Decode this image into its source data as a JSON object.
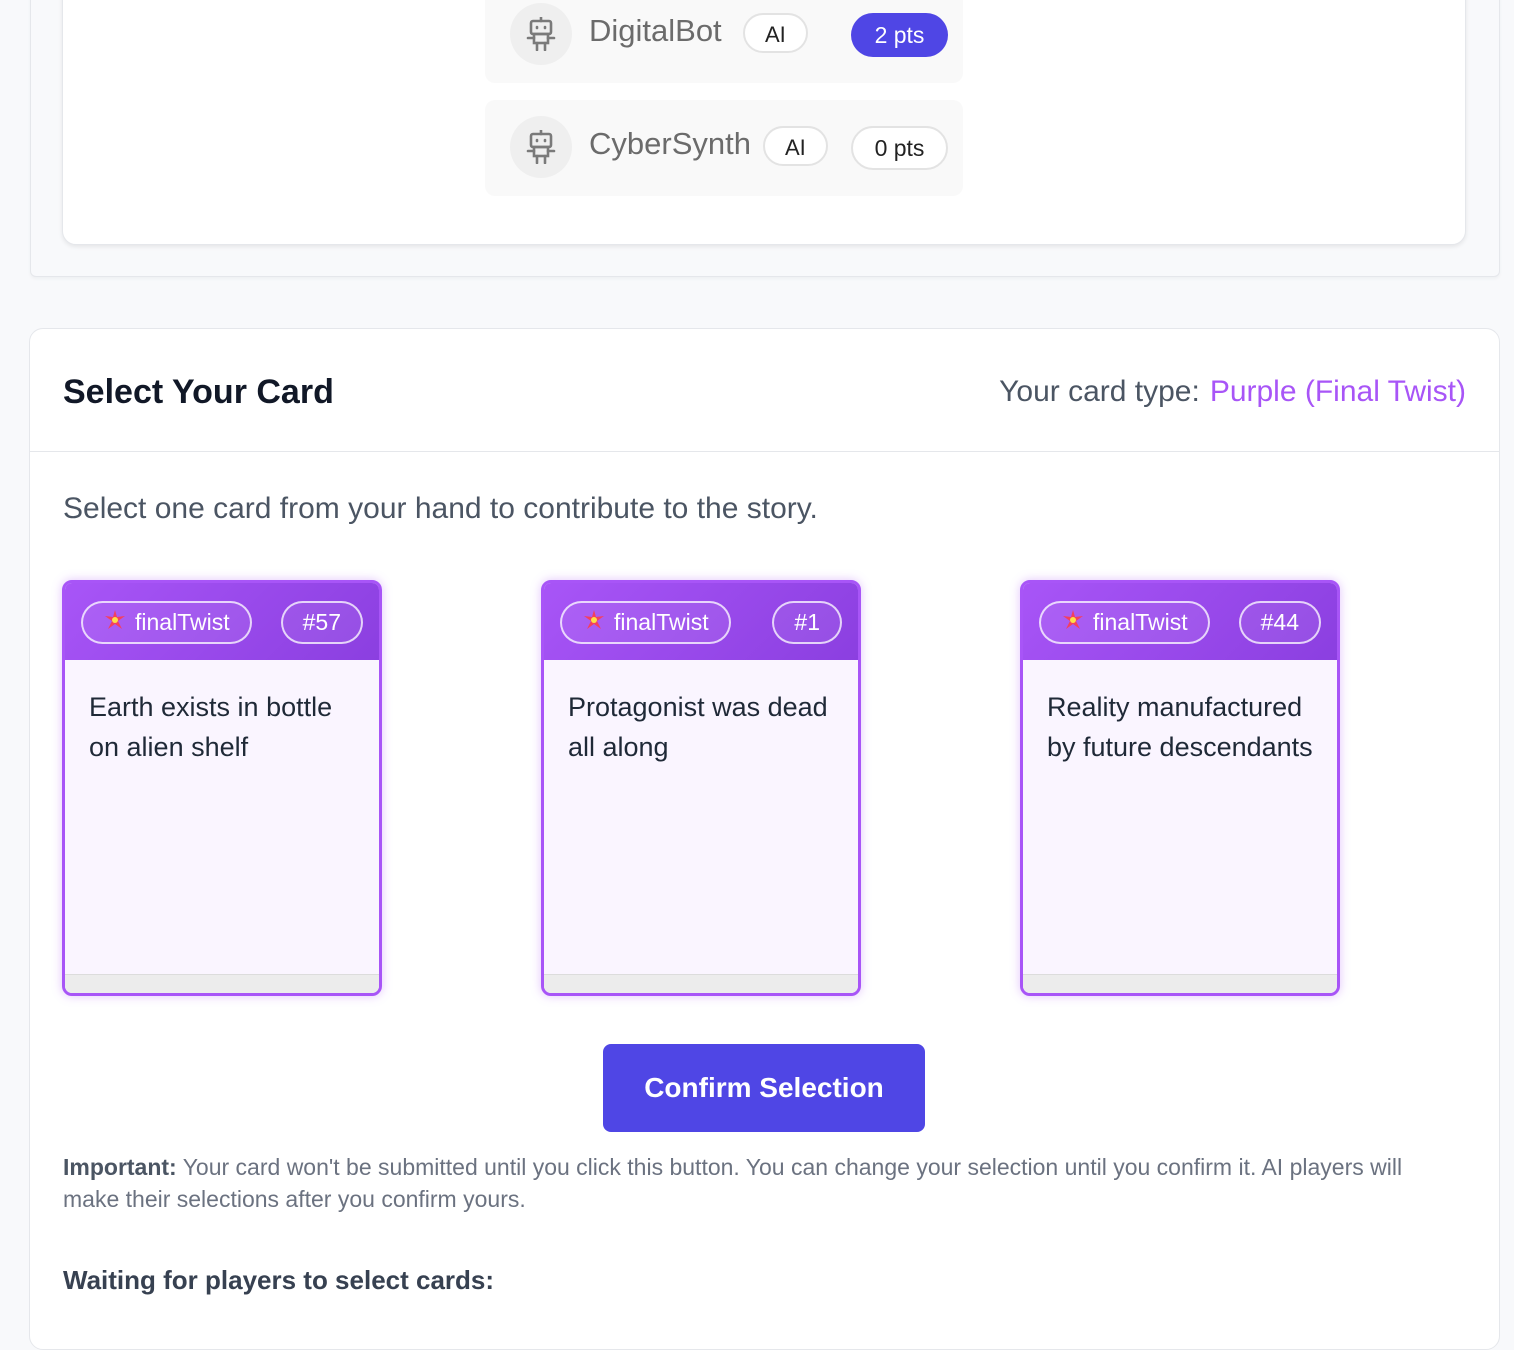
{
  "players": [
    {
      "name": "DigitalBot",
      "badge": "AI",
      "points": "2 pts",
      "icon": "robot-icon"
    },
    {
      "name": "CyberSynth",
      "badge": "AI",
      "points": "0 pts",
      "icon": "robot-icon"
    }
  ],
  "select": {
    "title": "Select Your Card",
    "type_label": "Your card type:",
    "type_value": "Purple (Final Twist)",
    "instructions": "Select one card from your hand to contribute to the story."
  },
  "cards": [
    {
      "type": "finalTwist",
      "number": "#57",
      "text": "Earth exists in bottle on alien shelf",
      "icon": "sparkle-icon"
    },
    {
      "type": "finalTwist",
      "number": "#1",
      "text": "Protagonist was dead all along",
      "icon": "sparkle-icon"
    },
    {
      "type": "finalTwist",
      "number": "#44",
      "text": "Reality manufactured by future descendants",
      "icon": "sparkle-icon"
    }
  ],
  "confirm_label": "Confirm Selection",
  "note": {
    "bold": "Important:",
    "text": " Your card won't be submitted until you click this button. You can change your selection until you confirm it. AI players will make their selections after you confirm yours."
  },
  "waiting_label": "Waiting for players to select cards:",
  "colors": {
    "accent": "#4f46e5",
    "purple": "#a855f7"
  }
}
